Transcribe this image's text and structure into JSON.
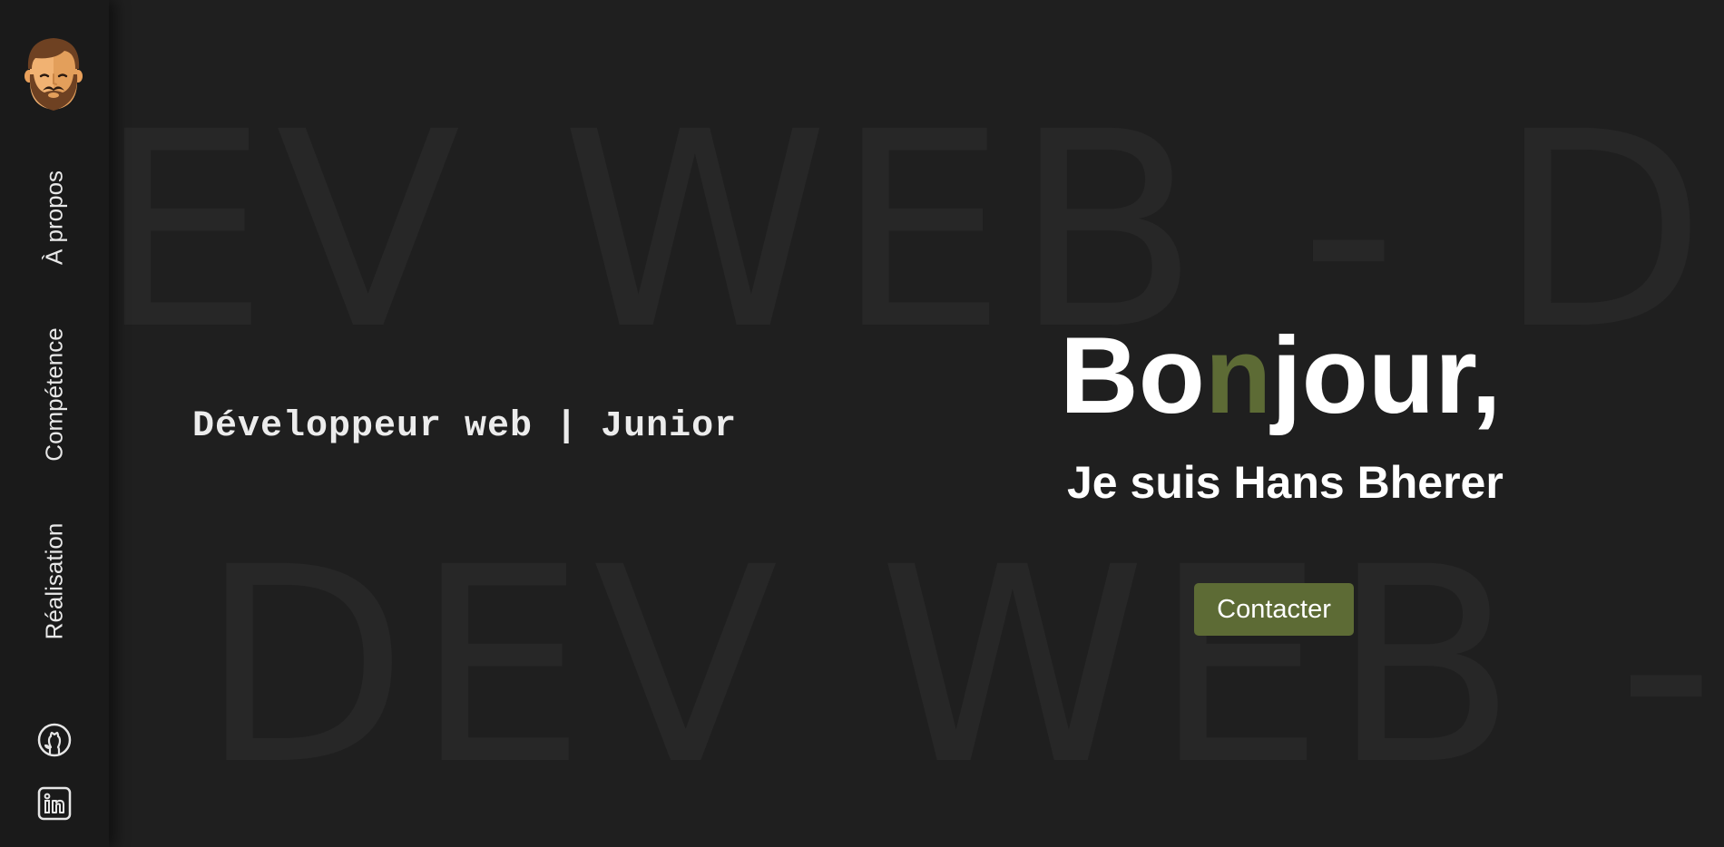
{
  "background": {
    "line_1": "DEV WEB - DEV WEB - DEV WEB",
    "line_2": "DEV WEB - DEV WEB - DEV WEB"
  },
  "sidebar": {
    "avatar_icon": "bearded-man-avatar",
    "items": [
      {
        "label": "À propos"
      },
      {
        "label": "Compétence"
      },
      {
        "label": "Réalisation"
      }
    ],
    "socials": [
      {
        "icon": "github-icon"
      },
      {
        "icon": "linkedin-icon"
      }
    ]
  },
  "hero": {
    "tagline": "Développeur web | Junior",
    "greeting_part1": "Bo",
    "greeting_accent": "n",
    "greeting_part2": "jour,",
    "intro": "Je suis Hans Bherer",
    "cta_label": "Contacter"
  },
  "colors": {
    "background": "#1f1f1f",
    "sidebar": "#1a1a1a",
    "accent": "#5d6b35",
    "text": "#ffffff"
  }
}
